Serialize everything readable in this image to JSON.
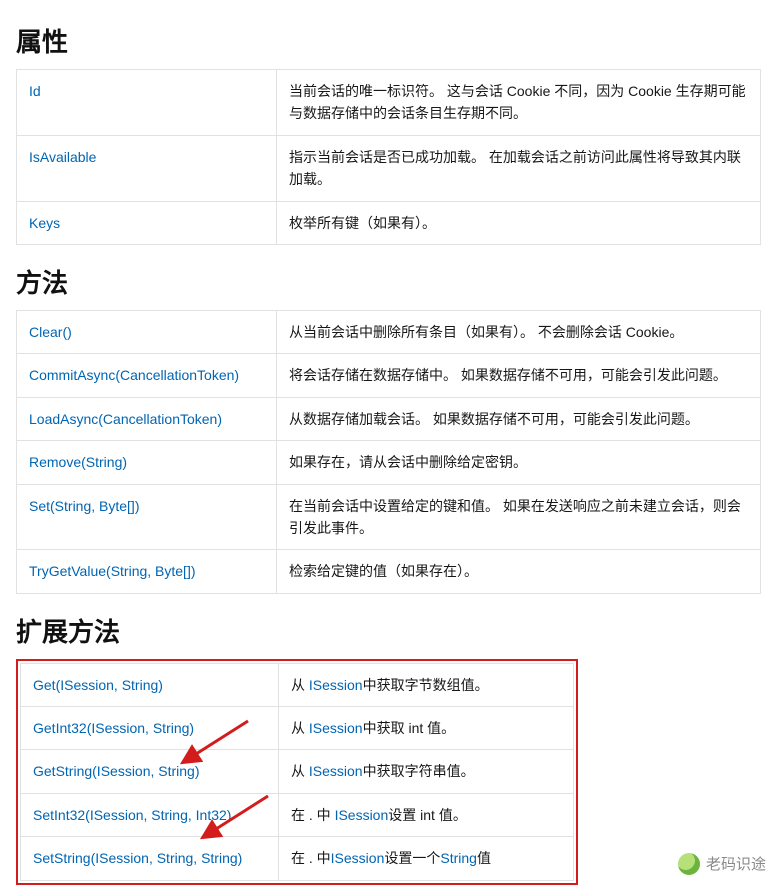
{
  "sections": {
    "properties": {
      "heading": "属性"
    },
    "methods": {
      "heading": "方法"
    },
    "extensions": {
      "heading": "扩展方法"
    }
  },
  "properties": [
    {
      "name": "Id",
      "desc": "当前会话的唯一标识符。 这与会话 Cookie 不同，因为 Cookie 生存期可能与数据存储中的会话条目生存期不同。"
    },
    {
      "name": "IsAvailable",
      "desc": "指示当前会话是否已成功加载。 在加载会话之前访问此属性将导致其内联加载。"
    },
    {
      "name": "Keys",
      "desc": "枚举所有键（如果有）。"
    }
  ],
  "methods": [
    {
      "name": "Clear()",
      "desc": "从当前会话中删除所有条目（如果有）。 不会删除会话 Cookie。"
    },
    {
      "name": "CommitAsync(CancellationToken)",
      "desc": "将会话存储在数据存储中。 如果数据存储不可用，可能会引发此问题。"
    },
    {
      "name": "LoadAsync(CancellationToken)",
      "desc": "从数据存储加载会话。 如果数据存储不可用，可能会引发此问题。"
    },
    {
      "name": "Remove(String)",
      "desc": "如果存在，请从会话中删除给定密钥。"
    },
    {
      "name": "Set(String, Byte[])",
      "desc": "在当前会话中设置给定的键和值。 如果在发送响应之前未建立会话，则会引发此事件。"
    },
    {
      "name": "TryGetValue(String, Byte[])",
      "desc": "检索给定键的值（如果存在）。"
    }
  ],
  "extensions": [
    {
      "name": "Get(ISession, String)",
      "pre": "从 ",
      "link": "ISession",
      "post": "中获取字节数组值。"
    },
    {
      "name": "GetInt32(ISession, String)",
      "pre": "从 ",
      "link": "ISession",
      "post": "中获取 int 值。"
    },
    {
      "name": "GetString(ISession, String)",
      "pre": "从 ",
      "link": "ISession",
      "post": "中获取字符串值。"
    },
    {
      "name": "SetInt32(ISession, String, Int32)",
      "pre": "在 . 中 ",
      "link": "ISession",
      "post": "设置 int 值。"
    },
    {
      "name": "SetString(ISession, String, String)",
      "pre": "在 . 中",
      "link": "ISession",
      "post": "设置一个",
      "link2": "String",
      "post2": "值"
    }
  ],
  "watermark": "老码识途"
}
